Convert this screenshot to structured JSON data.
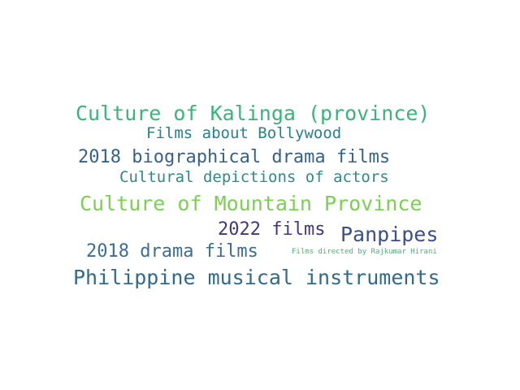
{
  "wordcloud": {
    "words": [
      {
        "text": "Culture of Kalinga (province)",
        "color": "#35b779"
      },
      {
        "text": "Films about Bollywood",
        "color": "#26828e"
      },
      {
        "text": "2018 biographical drama films",
        "color": "#33638d"
      },
      {
        "text": "Cultural depictions of actors",
        "color": "#2c8c8c"
      },
      {
        "text": "Culture of Mountain Province",
        "color": "#7ad151"
      },
      {
        "text": "2022 films",
        "color": "#463480"
      },
      {
        "text": "Panpipes",
        "color": "#3b4f8a"
      },
      {
        "text": "2018 drama films",
        "color": "#3b6e94"
      },
      {
        "text": "Films directed by Rajkumar Hirani",
        "color": "#3ebc73"
      },
      {
        "text": "Philippine musical instruments",
        "color": "#2f6b8e"
      }
    ]
  }
}
